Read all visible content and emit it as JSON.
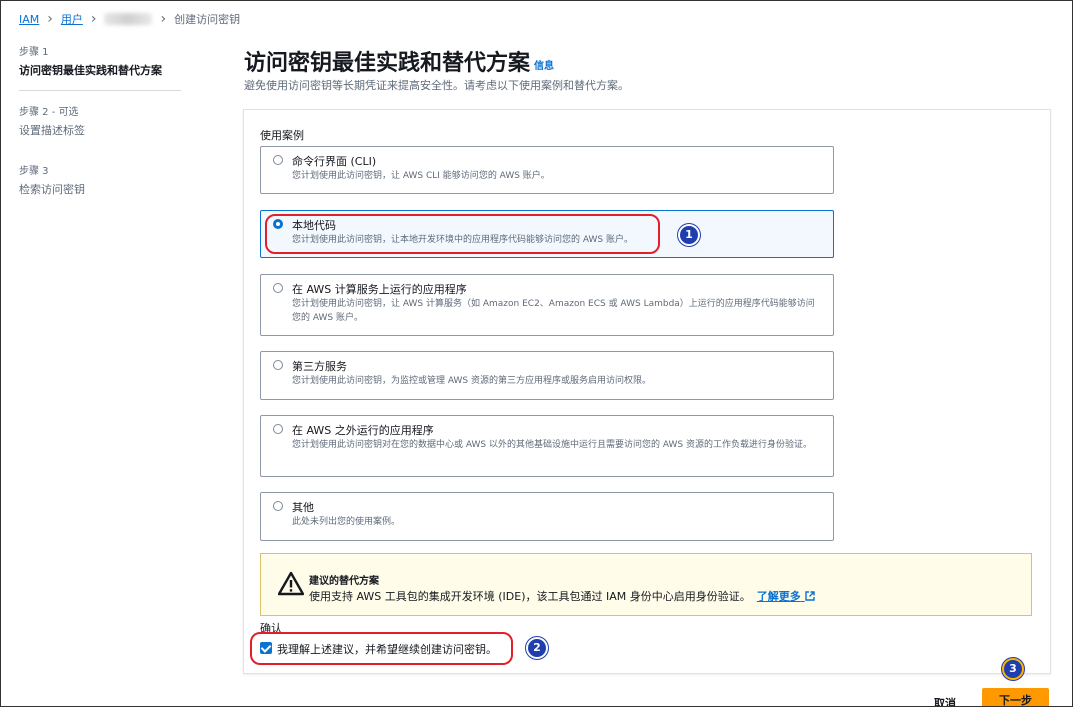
{
  "breadcrumb": {
    "iam": "IAM",
    "users": "用户",
    "current": "创建访问密钥"
  },
  "steps": [
    {
      "label": "步骤 1",
      "name": "访问密钥最佳实践和替代方案"
    },
    {
      "label": "步骤 2 - 可选",
      "name": "设置描述标签"
    },
    {
      "label": "步骤 3",
      "name": "检索访问密钥"
    }
  ],
  "header": {
    "title": "访问密钥最佳实践和替代方案",
    "info": "信息",
    "subtitle": "避免使用访问密钥等长期凭证来提高安全性。请考虑以下使用案例和替代方案。"
  },
  "use_cases": {
    "label": "使用案例",
    "options": [
      {
        "title": "命令行界面 (CLI)",
        "desc": "您计划使用此访问密钥，让 AWS CLI 能够访问您的 AWS 账户。"
      },
      {
        "title": "本地代码",
        "desc": "您计划使用此访问密钥，让本地开发环境中的应用程序代码能够访问您的 AWS 账户。"
      },
      {
        "title": "在 AWS 计算服务上运行的应用程序",
        "desc": "您计划使用此访问密钥，让 AWS 计算服务（如 Amazon EC2、Amazon ECS 或 AWS Lambda）上运行的应用程序代码能够访问您的 AWS 账户。"
      },
      {
        "title": "第三方服务",
        "desc": "您计划使用此访问密钥，为监控或管理 AWS 资源的第三方应用程序或服务启用访问权限。"
      },
      {
        "title": "在 AWS 之外运行的应用程序",
        "desc": "您计划使用此访问密钥对在您的数据中心或 AWS 以外的其他基础设施中运行且需要访问您的 AWS 资源的工作负载进行身份验证。"
      },
      {
        "title": "其他",
        "desc": "此处未列出您的使用案例。"
      }
    ],
    "selected_index": 1
  },
  "alert": {
    "title": "建议的替代方案",
    "desc": "使用支持 AWS 工具包的集成开发环境 (IDE)，该工具包通过 IAM 身份中心启用身份验证。",
    "link": "了解更多"
  },
  "confirm": {
    "label": "确认",
    "text": "我理解上述建议，并希望继续创建访问密钥。",
    "checked": true
  },
  "footer": {
    "cancel": "取消",
    "next": "下一步"
  },
  "annotations": {
    "badge1": "1",
    "badge2": "2",
    "badge3": "3"
  },
  "colors": {
    "link": "#0972d3",
    "primary_button": "#ff9900",
    "annotation_ring": "#e0202a",
    "annotation_badge": "#1f3fae"
  }
}
